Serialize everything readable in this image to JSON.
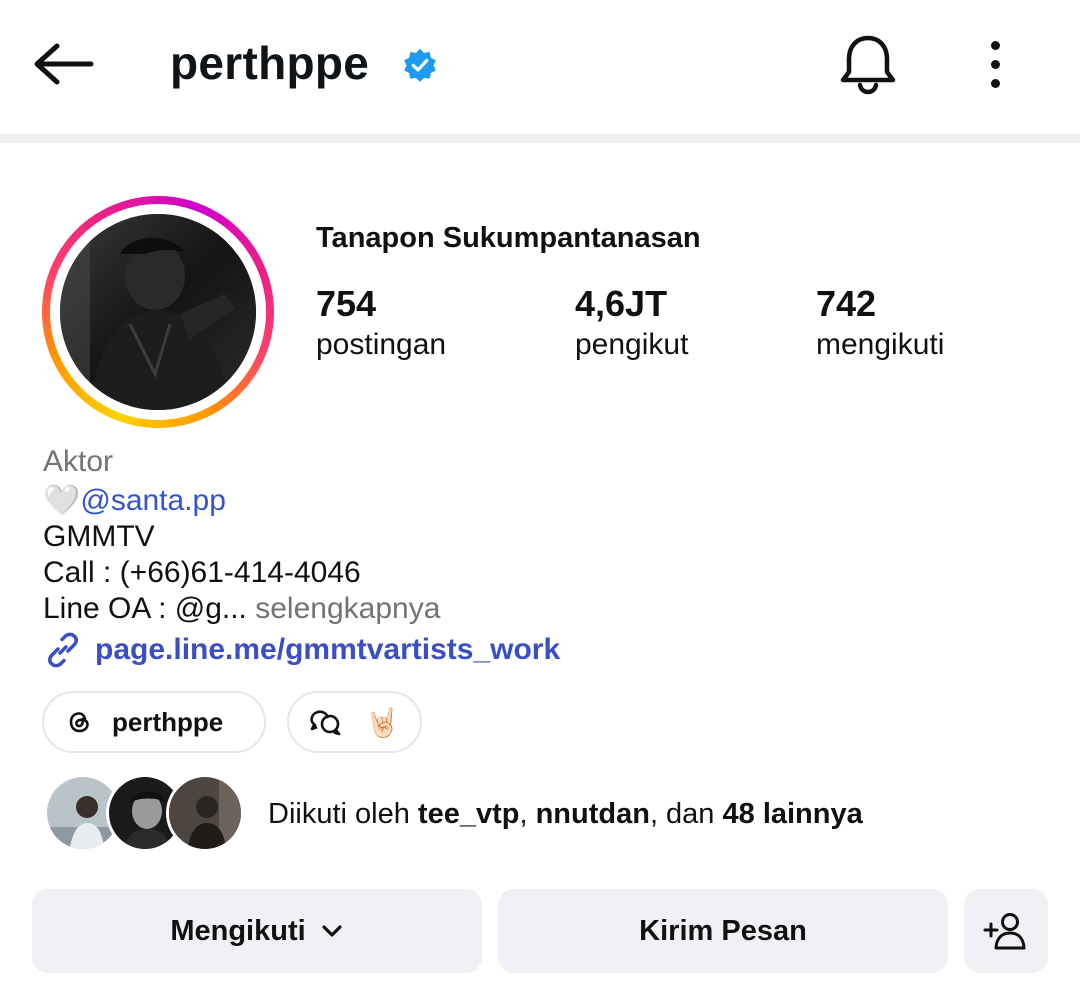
{
  "header": {
    "username": "perthppe",
    "icons": {
      "back": "arrow-left-icon",
      "verified": "verified-badge-icon",
      "bell": "bell-icon",
      "more": "more-vertical-icon"
    },
    "colors": {
      "verified": "#1d9bf0"
    }
  },
  "profile": {
    "full_name": "Tanapon Sukumpantanasan",
    "stats": [
      {
        "value": "754",
        "label": "postingan"
      },
      {
        "value": "4,6JT",
        "label": "pengikut"
      },
      {
        "value": "742",
        "label": "mengikuti"
      }
    ]
  },
  "bio": {
    "category": "Aktor",
    "heart": "🤍",
    "mention": "@santa.pp",
    "line3": "GMMTV",
    "line4": "Call : (+66)61-414-4046",
    "line5": "Line OA : @g...",
    "more": "selengkapnya",
    "link": "page.line.me/gmmtvartists_work"
  },
  "chips": {
    "threads_label": "perthppe",
    "chat_emoji": "🤘🏻"
  },
  "followed_by": {
    "prefix": "Diikuti oleh ",
    "user1": "tee_vtp",
    "sep": ", ",
    "user2": "nnutdan",
    "mid": ", dan ",
    "others": "48 lainnya"
  },
  "actions": {
    "follow_label": "Mengikuti",
    "message_label": "Kirim Pesan",
    "add_user_icon": "add-person-icon"
  }
}
